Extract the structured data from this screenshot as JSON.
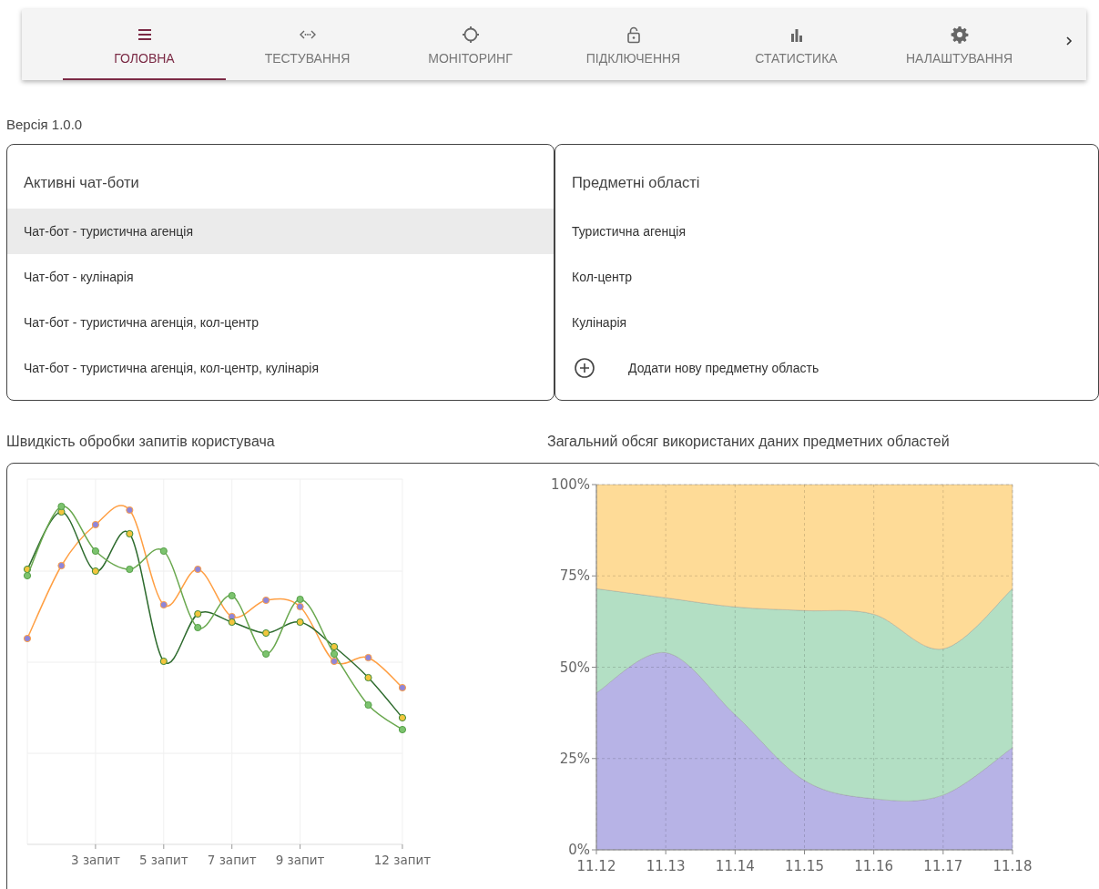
{
  "nav": {
    "tabs": [
      {
        "label": "ГОЛОВНА",
        "selected": true
      },
      {
        "label": "ТЕСТУВАННЯ",
        "selected": false
      },
      {
        "label": "МОНІТОРИНГ",
        "selected": false
      },
      {
        "label": "ПІДКЛЮЧЕННЯ",
        "selected": false
      },
      {
        "label": "СТАТИСТИКА",
        "selected": false
      },
      {
        "label": "НАЛАШТУВАННЯ",
        "selected": false
      }
    ]
  },
  "version": "Версія 1.0.0",
  "chatbots": {
    "title": "Активні чат-боти",
    "items": [
      {
        "label": "Чат-бот - туристична агенція",
        "selected": true
      },
      {
        "label": "Чат-бот - кулінарія",
        "selected": false
      },
      {
        "label": "Чат-бот - туристична агенція, кол-центр",
        "selected": false
      },
      {
        "label": "Чат-бот - туристична агенція, кол-центр, кулінарія",
        "selected": false
      }
    ]
  },
  "domains": {
    "title": "Предметні області",
    "items": [
      {
        "kind": "item",
        "label": "Туристична агенція"
      },
      {
        "kind": "item",
        "label": "Кол-центр"
      },
      {
        "kind": "item",
        "label": "Кулінарія"
      },
      {
        "kind": "add",
        "label": "Додати нову предметну область"
      }
    ]
  },
  "speed_chart": {
    "title": "Швидкість обробки запитів користувача",
    "x_labels": [
      "3 запит",
      "5 запит",
      "7 запит",
      "9 запит",
      "12 запит"
    ]
  },
  "volume_chart": {
    "title": "Загальний обсяг використаних даних предметних областей",
    "chart_data": {
      "type": "area",
      "stacked": true,
      "grid": true,
      "categories": [
        "11.12",
        "11.13",
        "11.14",
        "11.15",
        "11.16",
        "11.17",
        "11.18"
      ],
      "ylim": [
        0,
        100
      ],
      "yticks": [
        {
          "value": 0,
          "label": "0%"
        },
        {
          "value": 25,
          "label": "25%"
        },
        {
          "value": 50,
          "label": "50%"
        },
        {
          "value": 75,
          "label": "75%"
        },
        {
          "value": 100,
          "label": "100%"
        }
      ],
      "series": [
        {
          "color": "#b7b3e6",
          "values": [
            43,
            54,
            37,
            19,
            14,
            15,
            28
          ]
        },
        {
          "color": "#b3dfc4",
          "values": [
            28.5,
            15,
            29.5,
            46.5,
            50.5,
            40,
            43.5
          ]
        },
        {
          "color": "#fedb97",
          "values": [
            28.5,
            31,
            33.5,
            34.5,
            35.5,
            45,
            28.5
          ]
        }
      ]
    }
  }
}
